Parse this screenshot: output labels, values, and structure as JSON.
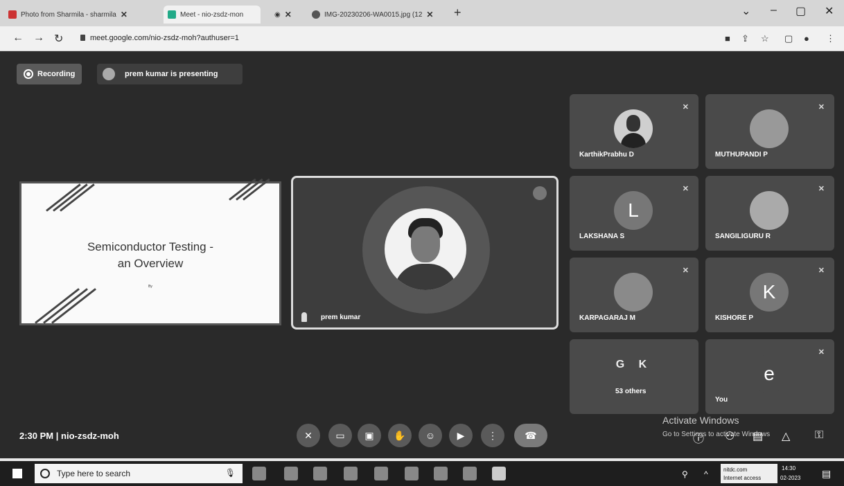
{
  "browser": {
    "tabs": [
      {
        "title": "Photo from Sharmila - sharmila"
      },
      {
        "title": "Meet - nio-zsdz-mon"
      },
      {
        "title": ""
      },
      {
        "title": "IMG-20230206-WA0015.jpg (12"
      }
    ],
    "url": "meet.google.com/nio-zsdz-moh?authuser=1"
  },
  "meet": {
    "recording_label": "Recording",
    "presenting_label": "prem kumar is presenting",
    "slide": {
      "title_line1": "Semiconductor Testing -",
      "title_line2": "an Overview",
      "byline": "By"
    },
    "speaker_name": "prem kumar",
    "participants": [
      {
        "name": "KarthikPrabhu D"
      },
      {
        "name": "MUTHUPANDI P"
      },
      {
        "name": "LAKSHANA S",
        "letter": "L"
      },
      {
        "name": "SANGILIGURU R"
      },
      {
        "name": "KARPAGARAJ M"
      },
      {
        "name": "KISHORE P",
        "letter": "K"
      },
      {
        "name": "53 others",
        "letters": "G K"
      },
      {
        "name": "You",
        "letter": "e"
      }
    ],
    "meeting_time": "2:30 PM",
    "separator": "|",
    "meeting_code": "nio-zsdz-moh",
    "activate_title": "Activate Windows",
    "activate_sub": "Go to Settings to activate Windows"
  },
  "taskbar": {
    "search_placeholder": "Type here to search",
    "tray_line1": "nitdc.com",
    "tray_line2": "Internet access",
    "time": "14:30",
    "date": "02-2023"
  }
}
